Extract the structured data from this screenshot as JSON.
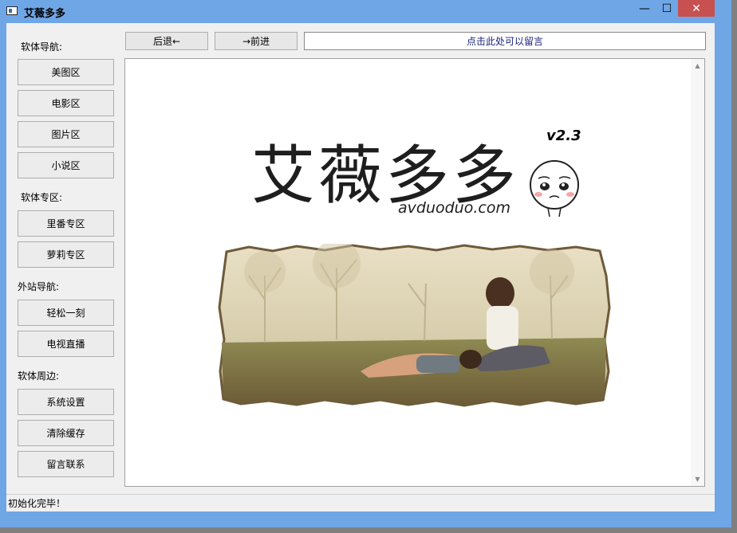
{
  "window": {
    "title": "艾薇多多"
  },
  "titlebar_buttons": {
    "minimize": "—",
    "maximize": "☐",
    "close": "✕"
  },
  "toolbar": {
    "back_label": "后退←",
    "forward_label": "→前进",
    "message_label": "点击此处可以留言"
  },
  "sidebar": {
    "sections": [
      {
        "heading": "软体导航:",
        "items": [
          "美图区",
          "电影区",
          "图片区",
          "小说区"
        ]
      },
      {
        "heading": "软体专区:",
        "items": [
          "里番专区",
          "萝莉专区"
        ]
      },
      {
        "heading": "外站导航:",
        "items": [
          "轻松一刻",
          "电视直播"
        ]
      },
      {
        "heading": "软体周边:",
        "items": [
          "系统设置",
          "清除缓存",
          "留言联系"
        ]
      }
    ]
  },
  "banner": {
    "logo_text": "艾薇多多",
    "version": "v2.3",
    "domain": "avduoduo.com"
  },
  "status": {
    "text": "初始化完毕！"
  },
  "colors": {
    "window_frame": "#6fa6e6",
    "close_button": "#c75050",
    "message_text": "#1a237e"
  }
}
